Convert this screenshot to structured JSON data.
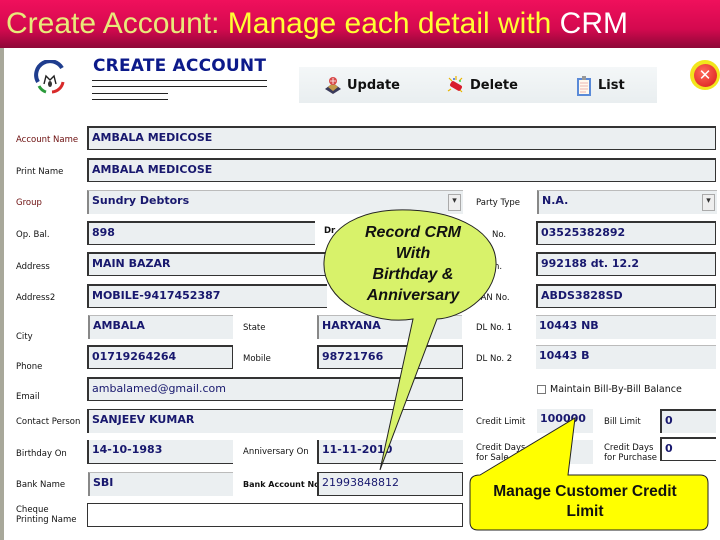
{
  "banner": {
    "part1": "Create Account: ",
    "part2": "Manage each detail with ",
    "part3": "CRM"
  },
  "colors": {
    "banner_bg": "#e00c55",
    "banner_text_pale": "#e8ea7a",
    "banner_text_yellow": "#ffff33",
    "header_title": "#0c1a8a",
    "field_text": "#18186e",
    "field_bg": "#ebeff1",
    "callout_green": "#d8f26a",
    "callout_yellow": "#ffff00"
  },
  "header": {
    "logo": "company-logo",
    "title": "CREATE ACCOUNT"
  },
  "toolbar": {
    "update": {
      "label": "Update",
      "icon": "update-icon"
    },
    "delete": {
      "label": "Delete",
      "icon": "delete-icon"
    },
    "list": {
      "label": "List",
      "icon": "clipboard-list-icon"
    },
    "close": {
      "label": "✕",
      "icon": "close-icon"
    }
  },
  "form": {
    "account_name": {
      "label": "Account Name",
      "value": "AMBALA MEDICOSE"
    },
    "print_name": {
      "label": "Print Name",
      "value": "AMBALA MEDICOSE"
    },
    "group": {
      "label": "Group",
      "value": "Sundry Debtors"
    },
    "party_type": {
      "label": "Party Type",
      "value": "N.A."
    },
    "op_bal": {
      "label": "Op. Bal.",
      "value": "898"
    },
    "dr_cr_label": "Dr",
    "field_no_1": {
      "label": "No.",
      "value": "03525382892"
    },
    "field_no_2": {
      "label": "n.",
      "value": "992188 dt. 12.2"
    },
    "pan_no": {
      "label": "PAN No.",
      "value": "ABDS3828SD"
    },
    "address": {
      "label": "Address",
      "value": "MAIN BAZAR"
    },
    "address2": {
      "label": "Address2",
      "value": "MOBILE-9417452387"
    },
    "city": {
      "label": "City",
      "value": "AMBALA"
    },
    "state": {
      "label": "State",
      "value": "HARYANA"
    },
    "dl_no_1": {
      "label": "DL No. 1",
      "value": "10443 NB"
    },
    "phone": {
      "label": "Phone",
      "value": "01719264264"
    },
    "mobile": {
      "label": "Mobile",
      "value": "98721766"
    },
    "dl_no_2": {
      "label": "DL No. 2",
      "value": "10443 B"
    },
    "email": {
      "label": "Email",
      "value": "ambalamed@gmail.com"
    },
    "maintain_bill_by_bill": {
      "label": "Maintain Bill-By-Bill Balance",
      "checked": false
    },
    "contact_person": {
      "label": "Contact Person",
      "value": "SANJEEV KUMAR"
    },
    "credit_limit": {
      "label": "Credit Limit",
      "value": "100000"
    },
    "bill_limit": {
      "label": "Bill Limit",
      "value": "0"
    },
    "birthday_on": {
      "label": "Birthday On",
      "value": "14-10-1983"
    },
    "anniversary_on": {
      "label": "Anniversary On",
      "value": "11-11-2010"
    },
    "credit_days_sale": {
      "label1": "Credit Days",
      "label2": "for Sale",
      "value": ""
    },
    "credit_days_purchase": {
      "label1": "Credit Days",
      "label2": "for Purchase",
      "value": "0"
    },
    "bank_name": {
      "label": "Bank Name",
      "value": "SBI"
    },
    "bank_account_no": {
      "label": "Bank Account No.",
      "value": "21993848812"
    },
    "cheque_printing_name": {
      "label1": "Cheque",
      "label2": "Printing Name",
      "value": ""
    }
  },
  "callouts": {
    "crm": {
      "line1": "Record CRM",
      "line2": "With",
      "line3": "Birthday &",
      "line4": "Anniversary"
    },
    "credit": {
      "line1": "Manage Customer Credit",
      "line2": "Limit"
    }
  }
}
